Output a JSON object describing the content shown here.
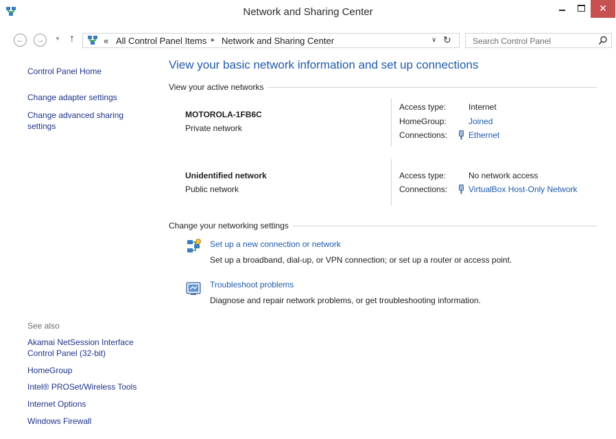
{
  "window": {
    "title": "Network and Sharing Center",
    "close_glyph": "✕"
  },
  "nav": {
    "back_glyph": "←",
    "forward_glyph": "→",
    "recent_glyph": "▼",
    "up_glyph": "↑",
    "breadcrumb_prefix": "«",
    "breadcrumbs": [
      "All Control Panel Items",
      "Network and Sharing Center"
    ],
    "crumb_separator": "▸",
    "dropdown_glyph": "∨",
    "refresh_glyph": "↻",
    "search_placeholder": "Search Control Panel"
  },
  "sidebar": {
    "home": "Control Panel Home",
    "links": [
      "Change adapter settings",
      "Change advanced sharing settings"
    ],
    "see_also_title": "See also",
    "see_also": [
      "Akamai NetSession Interface Control Panel (32-bit)",
      "HomeGroup",
      "Intel® PROSet/Wireless Tools",
      "Internet Options",
      "Windows Firewall"
    ]
  },
  "main": {
    "heading": "View your basic network information and set up connections",
    "active_title": "View your active networks",
    "networks": [
      {
        "name": "MOTOROLA-1FB6C",
        "category": "Private network",
        "access_label": "Access type:",
        "access_value": "Internet",
        "homegroup_label": "HomeGroup:",
        "homegroup_value": "Joined",
        "connections_label": "Connections:",
        "connections_value": "Ethernet"
      },
      {
        "name": "Unidentified network",
        "category": "Public network",
        "access_label": "Access type:",
        "access_value": "No network access",
        "connections_label": "Connections:",
        "connections_value": "VirtualBox Host-Only Network"
      }
    ],
    "settings_title": "Change your networking settings",
    "tasks": [
      {
        "link": "Set up a new connection or network",
        "desc": "Set up a broadband, dial-up, or VPN connection; or set up a router or access point."
      },
      {
        "link": "Troubleshoot problems",
        "desc": "Diagnose and repair network problems, or get troubleshooting information."
      }
    ]
  },
  "icons": {
    "app": "network-icon",
    "address": "control-panel-network-icon",
    "search": "search-icon",
    "connection": "ethernet-plug-icon",
    "task1": "new-connection-icon",
    "task2": "troubleshoot-icon"
  },
  "colors": {
    "link": "#1e5aa8",
    "sidebar_link": "#1e3287",
    "close_button": "#c75050"
  }
}
